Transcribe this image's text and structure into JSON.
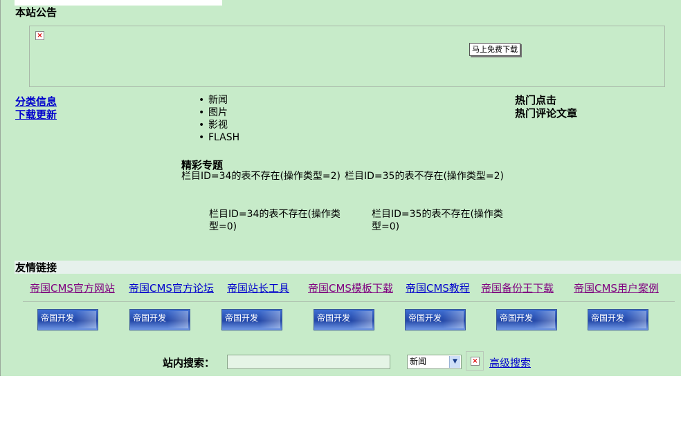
{
  "notice": {
    "title": "本站公告",
    "download_button": "马上免费下载"
  },
  "left_links": [
    "分类信息",
    "下载更新"
  ],
  "categories": [
    "新闻",
    "图片",
    "影视",
    "FLASH"
  ],
  "hot": {
    "clicks": "热门点击",
    "comments": "热门评论文章"
  },
  "special": {
    "title": "精彩专题",
    "errors": [
      "栏目ID=34的表不存在(操作类型=2)",
      "栏目ID=35的表不存在(操作类型=2)",
      "栏目ID=34的表不存在(操作类型=0)",
      "栏目ID=35的表不存在(操作类型=0)"
    ]
  },
  "friend_links": {
    "title": "友情链接",
    "links": [
      "帝国CMS官方网站",
      "帝国CMS官方论坛",
      "帝国站长工具",
      "帝国CMS模板下载",
      "帝国CMS教程",
      "帝国备份王下载",
      "帝国CMS用户案例"
    ],
    "logo_label": "帝国开发"
  },
  "search": {
    "label": "站内搜索：",
    "value": "",
    "selected": "新闻",
    "advanced": "高级搜索"
  }
}
